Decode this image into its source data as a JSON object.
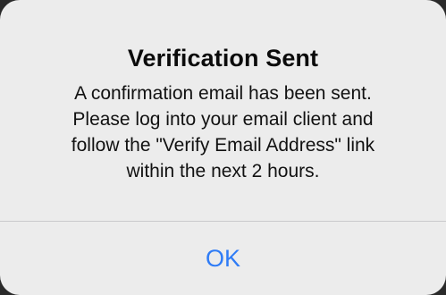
{
  "alert": {
    "title": "Verification Sent",
    "message_lines": [
      "A confirmation email has been sent.",
      "Please log into your email client and",
      "follow the \"Verify Email Address\" link",
      "within the next 2 hours."
    ],
    "ok_label": "OK"
  },
  "colors": {
    "button_tint": "#2f7cf6",
    "alert_background": "#ececec",
    "separator": "#c9c9cc"
  }
}
